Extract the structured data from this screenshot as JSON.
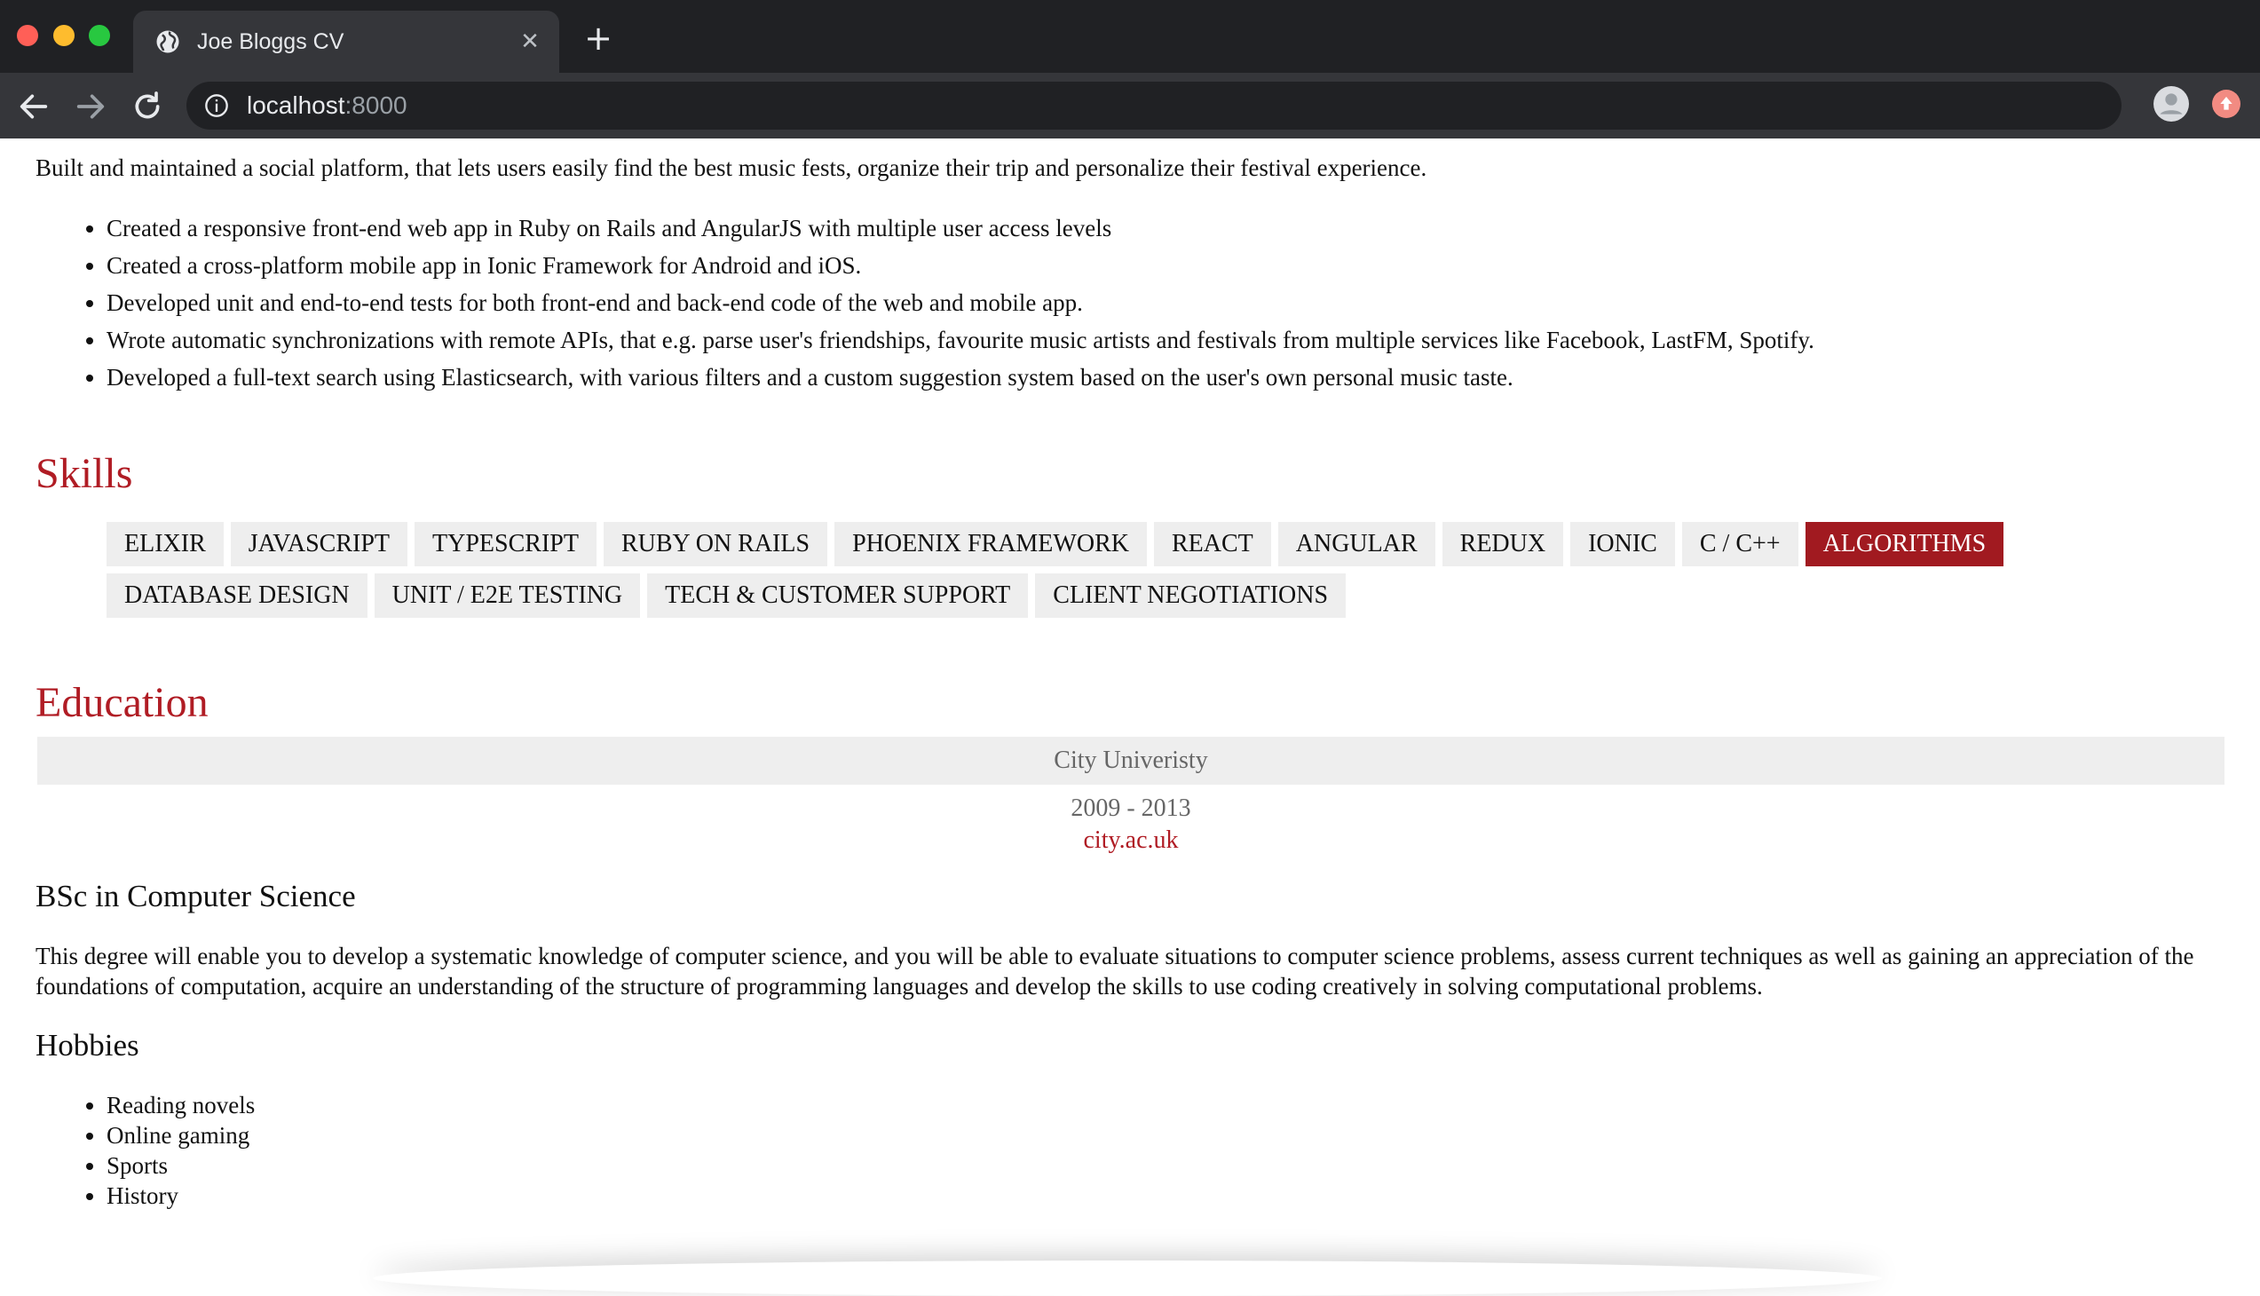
{
  "browser": {
    "tab_title": "Joe Bloggs CV",
    "url_host": "localhost",
    "url_port": ":8000"
  },
  "experience": {
    "summary": "Built and maintained a social platform, that lets users easily find the best music fests, organize their trip and personalize their festival experience.",
    "bullets": [
      "Created a responsive front-end web app in Ruby on Rails and AngularJS with multiple user access levels",
      "Created a cross-platform mobile app in Ionic Framework for Android and iOS.",
      "Developed unit and end-to-end tests for both front-end and back-end code of the web and mobile app.",
      "Wrote automatic synchronizations with remote APIs, that e.g. parse user's friendships, favourite music artists and festivals from multiple services like Facebook, LastFM, Spotify.",
      "Developed a full-text search using Elasticsearch, with various filters and a custom suggestion system based on the user's own personal music taste."
    ]
  },
  "skills": {
    "heading": "Skills",
    "items": [
      "ELIXIR",
      "JAVASCRIPT",
      "TYPESCRIPT",
      "RUBY ON RAILS",
      "PHOENIX FRAMEWORK",
      "REACT",
      "ANGULAR",
      "REDUX",
      "IONIC",
      "C / C++",
      "ALGORITHMS",
      "DATABASE DESIGN",
      "UNIT / E2E TESTING",
      "TECH & CUSTOMER SUPPORT",
      "CLIENT NEGOTIATIONS"
    ],
    "active": "ALGORITHMS"
  },
  "education": {
    "heading": "Education",
    "school": "City Univeristy",
    "years": "2009 - 2013",
    "link": "city.ac.uk",
    "degree": "BSc in Computer Science",
    "description": "This degree will enable you to develop a systematic knowledge of computer science, and you will be able to evaluate situations to computer science problems, assess current techniques as well as gaining an appreciation of the foundations of computation, acquire an understanding of the structure of programming languages and develop the skills to use coding creatively in solving computational problems."
  },
  "hobbies": {
    "heading": "Hobbies",
    "items": [
      "Reading novels",
      "Online gaming",
      "Sports",
      "History"
    ]
  },
  "colors": {
    "accent": "#b01c24",
    "chip_bg": "#eeeeee",
    "chip_active_bg": "#a11a20"
  }
}
